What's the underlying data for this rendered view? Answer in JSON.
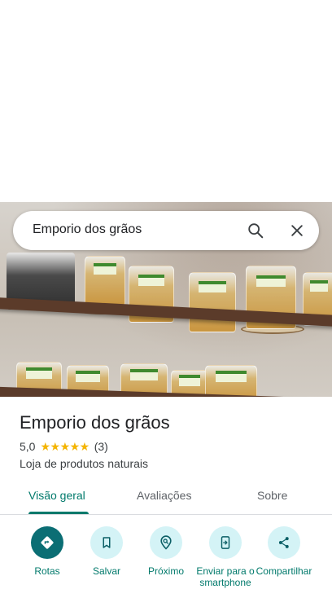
{
  "search": {
    "query": "Emporio dos grãos",
    "search_icon": "search-icon",
    "close_icon": "close-icon"
  },
  "place": {
    "name": "Emporio dos grãos",
    "rating": "5,0",
    "stars": "★★★★★",
    "review_count": "(3)",
    "category": "Loja de produtos naturais"
  },
  "tabs": [
    {
      "label": "Visão geral",
      "active": true
    },
    {
      "label": "Avaliações",
      "active": false
    },
    {
      "label": "Sobre",
      "active": false
    }
  ],
  "actions": [
    {
      "label": "Rotas",
      "icon": "directions-icon"
    },
    {
      "label": "Salvar",
      "icon": "bookmark-icon"
    },
    {
      "label": "Próximo",
      "icon": "nearby-icon"
    },
    {
      "label": "Enviar para o smartphone",
      "icon": "send-to-phone-icon"
    },
    {
      "label": "Compartilhar",
      "icon": "share-icon"
    }
  ],
  "colors": {
    "accent": "#00796b",
    "primary_button": "#0b6e74",
    "button_tint": "#d4f3f6",
    "star": "#f4b400"
  }
}
